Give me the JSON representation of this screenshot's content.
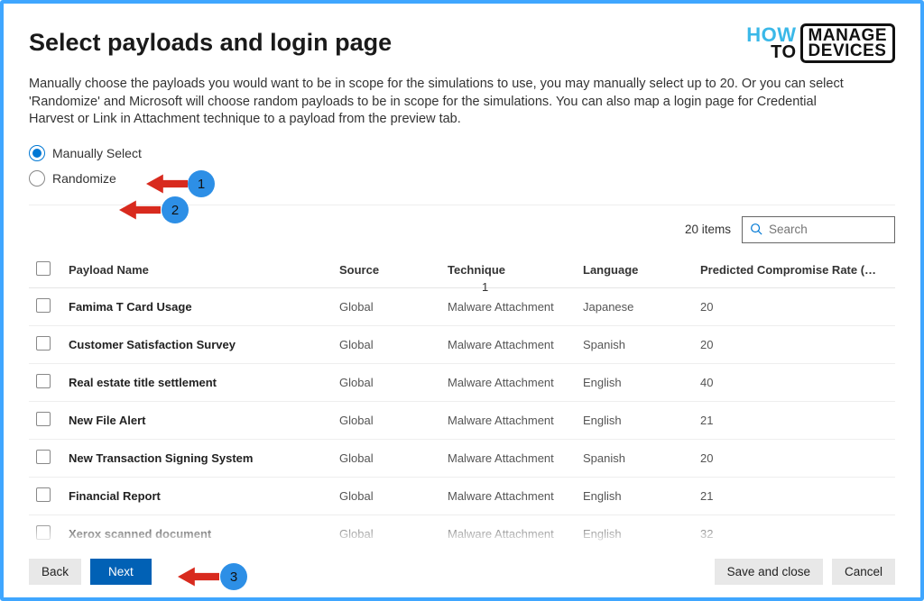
{
  "header": {
    "title": "Select payloads and login page",
    "description": "Manually choose the payloads you would want to be in scope for the simulations to use, you may manually select up to 20. Or you can select 'Randomize' and Microsoft will choose random payloads to be in scope for the simulations. You can also map a login page for Credential Harvest or Link in Attachment technique to a payload from the preview tab.",
    "logo": {
      "how": "HOW",
      "to": "TO",
      "manage": "MANAGE",
      "devices": "DEVICES"
    }
  },
  "options": {
    "manual_select": "Manually Select",
    "randomize": "Randomize"
  },
  "toolbar": {
    "item_count": "20 items",
    "search_placeholder": "Search"
  },
  "columns": {
    "name": "Payload Name",
    "source": "Source",
    "technique": "Technique",
    "language": "Language",
    "rate": "Predicted Compromise Rate (…"
  },
  "rows": [
    {
      "name": "Famima T Card Usage",
      "source": "Global",
      "technique": "Malware Attachment",
      "language": "Japanese",
      "rate": "20"
    },
    {
      "name": "Customer Satisfaction Survey",
      "source": "Global",
      "technique": "Malware Attachment",
      "language": "Spanish",
      "rate": "20"
    },
    {
      "name": "Real estate title settlement",
      "source": "Global",
      "technique": "Malware Attachment",
      "language": "English",
      "rate": "40"
    },
    {
      "name": "New File Alert",
      "source": "Global",
      "technique": "Malware Attachment",
      "language": "English",
      "rate": "21"
    },
    {
      "name": "New Transaction Signing System",
      "source": "Global",
      "technique": "Malware Attachment",
      "language": "Spanish",
      "rate": "20"
    },
    {
      "name": "Financial Report",
      "source": "Global",
      "technique": "Malware Attachment",
      "language": "English",
      "rate": "21"
    },
    {
      "name": "Xerox scanned document",
      "source": "Global",
      "technique": "Malware Attachment",
      "language": "English",
      "rate": "32"
    }
  ],
  "footer": {
    "back": "Back",
    "next": "Next",
    "save": "Save and close",
    "cancel": "Cancel"
  },
  "annotations": {
    "n1": "1",
    "n2": "2",
    "n3": "3",
    "stray": "1"
  }
}
